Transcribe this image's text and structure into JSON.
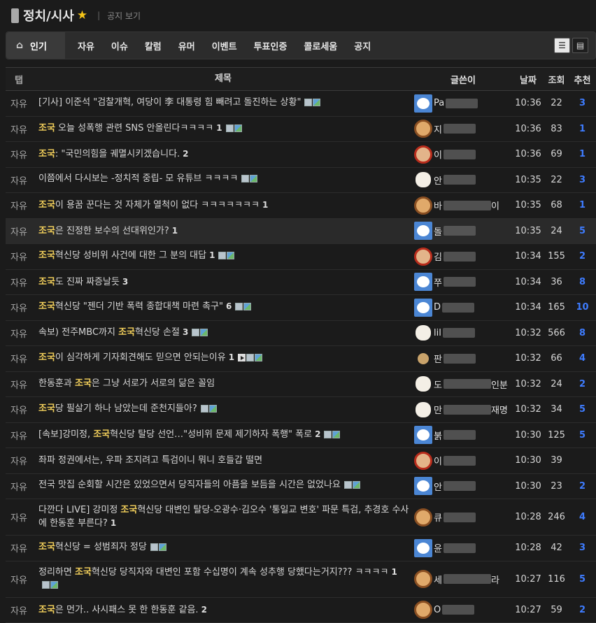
{
  "header": {
    "title": "정치/시사",
    "notice_link": "공지 보기"
  },
  "tabs": {
    "home": "인기",
    "items": [
      "자유",
      "이슈",
      "칼럼",
      "유머",
      "이벤트",
      "투표인증",
      "콜로세움",
      "공지"
    ]
  },
  "columns": {
    "tag": "탭",
    "title": "제목",
    "author": "글쓴이",
    "date": "날짜",
    "views": "조회",
    "rec": "추천"
  },
  "colors": {
    "keyword": "#f2cf5b",
    "recommend": "#3e7cff"
  },
  "rows": [
    {
      "tag": "자유",
      "parts": [
        {
          "t": "[기사] 이준석 \"검찰개혁, 여당이 李 대통령 힘 빼려고 돌진하는 상황\""
        }
      ],
      "comments": "",
      "attach": [
        "doc",
        "img"
      ],
      "avatar": "bear",
      "author": "Pa",
      "date": "10:36",
      "views": "22",
      "rec": "3"
    },
    {
      "tag": "자유",
      "parts": [
        {
          "t": "조국",
          "k": true
        },
        {
          "t": " 오늘 성폭행 관련 SNS 안올린다ㅋㅋㅋㅋ"
        }
      ],
      "comments": "1",
      "attach": [
        "doc",
        "img"
      ],
      "avatar": "puppy",
      "author": "지",
      "date": "10:36",
      "views": "83",
      "rec": "1"
    },
    {
      "tag": "자유",
      "parts": [
        {
          "t": "조국",
          "k": true
        },
        {
          "t": ": \"국민의힘을 궤멸시키겠습니다."
        }
      ],
      "comments": "2",
      "attach": [],
      "avatar": "red",
      "author": "이",
      "date": "10:36",
      "views": "69",
      "rec": "1"
    },
    {
      "tag": "자유",
      "parts": [
        {
          "t": "이쯤에서 다시보는 -정치적 중립- 모 유튜브 ㅋㅋㅋㅋ"
        }
      ],
      "comments": "",
      "attach": [
        "doc",
        "img"
      ],
      "avatar": "white",
      "author": "안",
      "date": "10:35",
      "views": "22",
      "rec": "3"
    },
    {
      "tag": "자유",
      "parts": [
        {
          "t": "조국",
          "k": true
        },
        {
          "t": "이 용꿈 꾼다는 것 자체가 열척이 없다 ㅋㅋㅋㅋㅋㅋㅋ"
        }
      ],
      "comments": "1",
      "attach": [],
      "avatar": "puppy",
      "author": "바",
      "suffix": "이",
      "date": "10:35",
      "views": "68",
      "rec": "1"
    },
    {
      "tag": "자유",
      "parts": [
        {
          "t": "조국",
          "k": true
        },
        {
          "t": "은 진정한 보수의 선대위인가?"
        }
      ],
      "comments": "1",
      "attach": [],
      "avatar": "bear",
      "author": "돌",
      "date": "10:35",
      "views": "24",
      "rec": "5",
      "hl": true
    },
    {
      "tag": "자유",
      "parts": [
        {
          "t": "조국",
          "k": true
        },
        {
          "t": "혁신당 성비위 사건에 대한 그 분의 대답"
        }
      ],
      "comments": "1",
      "attach": [
        "doc",
        "img"
      ],
      "avatar": "red",
      "author": "김",
      "date": "10:34",
      "views": "155",
      "rec": "2"
    },
    {
      "tag": "자유",
      "parts": [
        {
          "t": "조국",
          "k": true
        },
        {
          "t": "도 진짜 짜증날듯"
        }
      ],
      "comments": "3",
      "attach": [],
      "avatar": "bear",
      "author": "쭈",
      "date": "10:34",
      "views": "36",
      "rec": "8"
    },
    {
      "tag": "자유",
      "parts": [
        {
          "t": "조국",
          "k": true
        },
        {
          "t": "혁신당 \"젠더 기반 폭력 종합대책 마련 촉구\""
        }
      ],
      "comments": "6",
      "attach": [
        "doc",
        "img"
      ],
      "avatar": "bear",
      "author": "D",
      "date": "10:34",
      "views": "165",
      "rec": "10"
    },
    {
      "tag": "자유",
      "parts": [
        {
          "t": "속보) 전주MBC까지 "
        },
        {
          "t": "조국",
          "k": true
        },
        {
          "t": "혁신당 손절"
        }
      ],
      "comments": "3",
      "attach": [
        "doc",
        "img"
      ],
      "avatar": "white",
      "author": "lil",
      "date": "10:32",
      "views": "566",
      "rec": "8"
    },
    {
      "tag": "자유",
      "parts": [
        {
          "t": "조국",
          "k": true
        },
        {
          "t": "이 심각하게 기자회견해도 믿으면 안되는이유"
        }
      ],
      "comments": "1",
      "attach": [
        "vid",
        "doc",
        "img"
      ],
      "avatar": "dot",
      "author": "판",
      "date": "10:32",
      "views": "66",
      "rec": "4"
    },
    {
      "tag": "자유",
      "parts": [
        {
          "t": "한동훈과 "
        },
        {
          "t": "조국",
          "k": true
        },
        {
          "t": "은 그냥 서로가 서로의 닮은 꼴임"
        }
      ],
      "comments": "",
      "attach": [],
      "avatar": "white",
      "author": "도",
      "suffix": "인분",
      "date": "10:32",
      "views": "24",
      "rec": "2"
    },
    {
      "tag": "자유",
      "parts": [
        {
          "t": "조국",
          "k": true
        },
        {
          "t": "당 필살기 하나 남았는데 준천지들아?"
        }
      ],
      "comments": "",
      "attach": [
        "doc",
        "img"
      ],
      "avatar": "white",
      "author": "만",
      "suffix": "재명",
      "date": "10:32",
      "views": "34",
      "rec": "5"
    },
    {
      "tag": "자유",
      "parts": [
        {
          "t": "[속보]강미정, "
        },
        {
          "t": "조국",
          "k": true
        },
        {
          "t": "혁신당 탈당 선언…\"성비위 문제 제기하자 폭행\" 폭로"
        }
      ],
      "comments": "2",
      "attach": [
        "doc",
        "img"
      ],
      "avatar": "bear",
      "author": "붉",
      "date": "10:30",
      "views": "125",
      "rec": "5"
    },
    {
      "tag": "자유",
      "parts": [
        {
          "t": "좌파 정권에서는, 우파 조지려고 특검이니 뭐니 호들갑 떨면"
        }
      ],
      "comments": "",
      "attach": [],
      "avatar": "red",
      "author": "이",
      "date": "10:30",
      "views": "39",
      "rec": ""
    },
    {
      "tag": "자유",
      "parts": [
        {
          "t": "전국 맛집 순회할 시간은 있었으면서 당직자들의 아픔을 보듬을 시간은 없었나요"
        }
      ],
      "comments": "",
      "attach": [
        "doc",
        "img"
      ],
      "avatar": "bear",
      "author": "안",
      "date": "10:30",
      "views": "23",
      "rec": "2"
    },
    {
      "tag": "자유",
      "parts": [
        {
          "t": "다깐다 LIVE] 강미정 "
        },
        {
          "t": "조국",
          "k": true
        },
        {
          "t": "혁신당 대변인 탈당-오광수·김오수 '통일교 변호' 파문 특검, 추경호 수사에 한동훈 부른다?"
        }
      ],
      "comments": "1",
      "attach": [],
      "avatar": "puppy",
      "author": "큐",
      "date": "10:28",
      "views": "246",
      "rec": "4",
      "tall": true
    },
    {
      "tag": "자유",
      "parts": [
        {
          "t": "조국",
          "k": true
        },
        {
          "t": "혁신당 = 성범죄자 정당"
        }
      ],
      "comments": "",
      "attach": [
        "doc",
        "img"
      ],
      "avatar": "bear",
      "author": "윤",
      "date": "10:28",
      "views": "42",
      "rec": "3"
    },
    {
      "tag": "자유",
      "parts": [
        {
          "t": "정리하면 "
        },
        {
          "t": "조국",
          "k": true
        },
        {
          "t": "혁신당 당직자와 대변인 포함 수십명이 계속 성추행 당했다는거지??? ㅋㅋㅋㅋ"
        }
      ],
      "comments": "1",
      "attach": [
        "doc",
        "img"
      ],
      "avatar": "puppy",
      "author": "세",
      "suffix": "라",
      "date": "10:27",
      "views": "116",
      "rec": "5",
      "tall": true
    },
    {
      "tag": "자유",
      "parts": [
        {
          "t": "조국",
          "k": true
        },
        {
          "t": "은 먼가.. 사시패스 못 한 한동훈 같음."
        }
      ],
      "comments": "2",
      "attach": [],
      "avatar": "puppy",
      "author": "O",
      "date": "10:27",
      "views": "59",
      "rec": "2"
    }
  ]
}
